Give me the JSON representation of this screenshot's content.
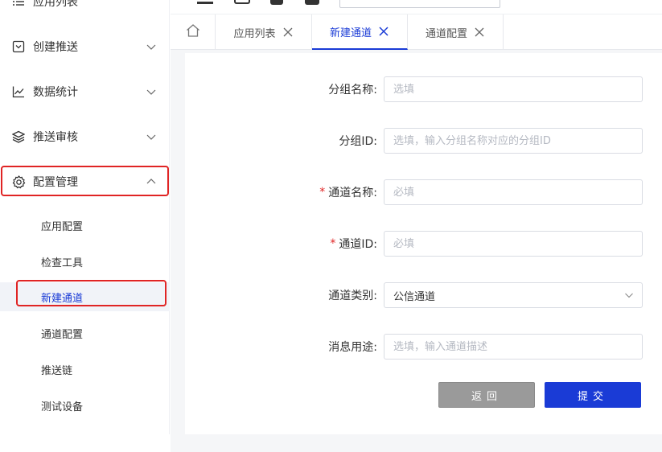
{
  "sidebar": {
    "top_item": "应用列表",
    "menus": [
      {
        "label": "创建推送",
        "icon": "send-box-icon",
        "expanded": false
      },
      {
        "label": "数据统计",
        "icon": "line-chart-icon",
        "expanded": false
      },
      {
        "label": "推送审核",
        "icon": "layers-icon",
        "expanded": false
      },
      {
        "label": "配置管理",
        "icon": "gear-icon",
        "expanded": true
      }
    ],
    "sub_items": [
      "应用配置",
      "检查工具",
      "新建通道",
      "通道配置",
      "推送链",
      "测试设备"
    ],
    "active_sub": "新建通道"
  },
  "tabs": [
    {
      "label": "应用列表",
      "active": false
    },
    {
      "label": "新建通道",
      "active": true
    },
    {
      "label": "通道配置",
      "active": false
    }
  ],
  "form": {
    "fields": [
      {
        "label": "分组名称:",
        "required": false,
        "placeholder": "选填",
        "value": ""
      },
      {
        "label": "分组ID:",
        "required": false,
        "placeholder": "选填，输入分组名称对应的分组ID",
        "value": ""
      },
      {
        "label": "通道名称:",
        "required": true,
        "placeholder": "必填",
        "value": ""
      },
      {
        "label": "通道ID:",
        "required": true,
        "placeholder": "必填",
        "value": ""
      },
      {
        "label": "通道类别:",
        "required": false,
        "type": "select",
        "value": "公信通道"
      },
      {
        "label": "消息用途:",
        "required": false,
        "placeholder": "选填，输入通道描述",
        "value": ""
      }
    ],
    "required_mark": "*",
    "back_label": "返回",
    "submit_label": "提交"
  },
  "colors": {
    "accent": "#1a3bd6",
    "highlight": "#e02424",
    "back_button": "#9a9a9a"
  }
}
